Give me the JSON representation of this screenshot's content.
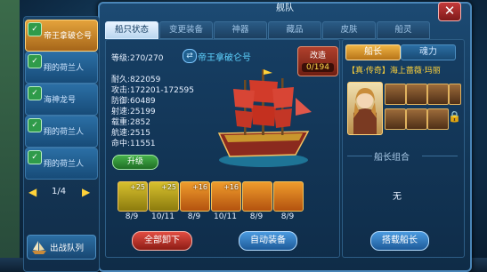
{
  "window": {
    "title": "舰队",
    "close_label": "✕"
  },
  "fleet_list": {
    "items": [
      {
        "name": "帝王拿破仑号",
        "active": true
      },
      {
        "name": "翔的荷兰人",
        "active": false
      },
      {
        "name": "海神龙号",
        "active": false
      },
      {
        "name": "翔的荷兰人",
        "active": false
      },
      {
        "name": "翔的荷兰人",
        "active": false
      }
    ],
    "page": "1/4",
    "prev_icon": "◀",
    "next_icon": "▶",
    "formation_label": "出战队列",
    "badge_icon": "✓"
  },
  "tabs": [
    {
      "label": "船只状态",
      "active": true
    },
    {
      "label": "变更装备",
      "active": false
    },
    {
      "label": "神器",
      "active": false
    },
    {
      "label": "藏品",
      "active": false
    },
    {
      "label": "皮肤",
      "active": false
    },
    {
      "label": "船灵",
      "active": false
    }
  ],
  "ship": {
    "name": "帝王拿破仑号",
    "level": "等级:270/270",
    "durability": "耐久:822059",
    "attack": "攻击:172201-172595",
    "defense": "防御:60489",
    "range": "射速:25199",
    "load": "载重:2852",
    "speed": "航速:2515",
    "accuracy": "命中:11551",
    "upgrade_label": "升级",
    "refit_label": "改造",
    "refit_count": "0/194"
  },
  "equipment": [
    {
      "level": "+25",
      "count": "8/9"
    },
    {
      "level": "+25",
      "count": "10/11"
    },
    {
      "level": "+16",
      "count": "8/9"
    },
    {
      "level": "+16",
      "count": "10/11"
    },
    {
      "level": "",
      "count": "8/9"
    },
    {
      "level": "",
      "count": "8/9"
    }
  ],
  "buttons": {
    "unequip_all": "全部卸下",
    "auto_equip": "自动装备",
    "board_captain": "搭载船长"
  },
  "captain": {
    "tabs": [
      {
        "label": "船长",
        "active": true
      },
      {
        "label": "魂力",
        "active": false
      }
    ],
    "title": "【真·传奇】海上蔷薇·玛丽",
    "combo_title": "船长组合",
    "combo_value": "无"
  },
  "colors": {
    "accent_gold": "#ffd23a",
    "panel_blue": "#1c4a73",
    "button_red": "#e24d42",
    "button_blue": "#4b9be0"
  }
}
